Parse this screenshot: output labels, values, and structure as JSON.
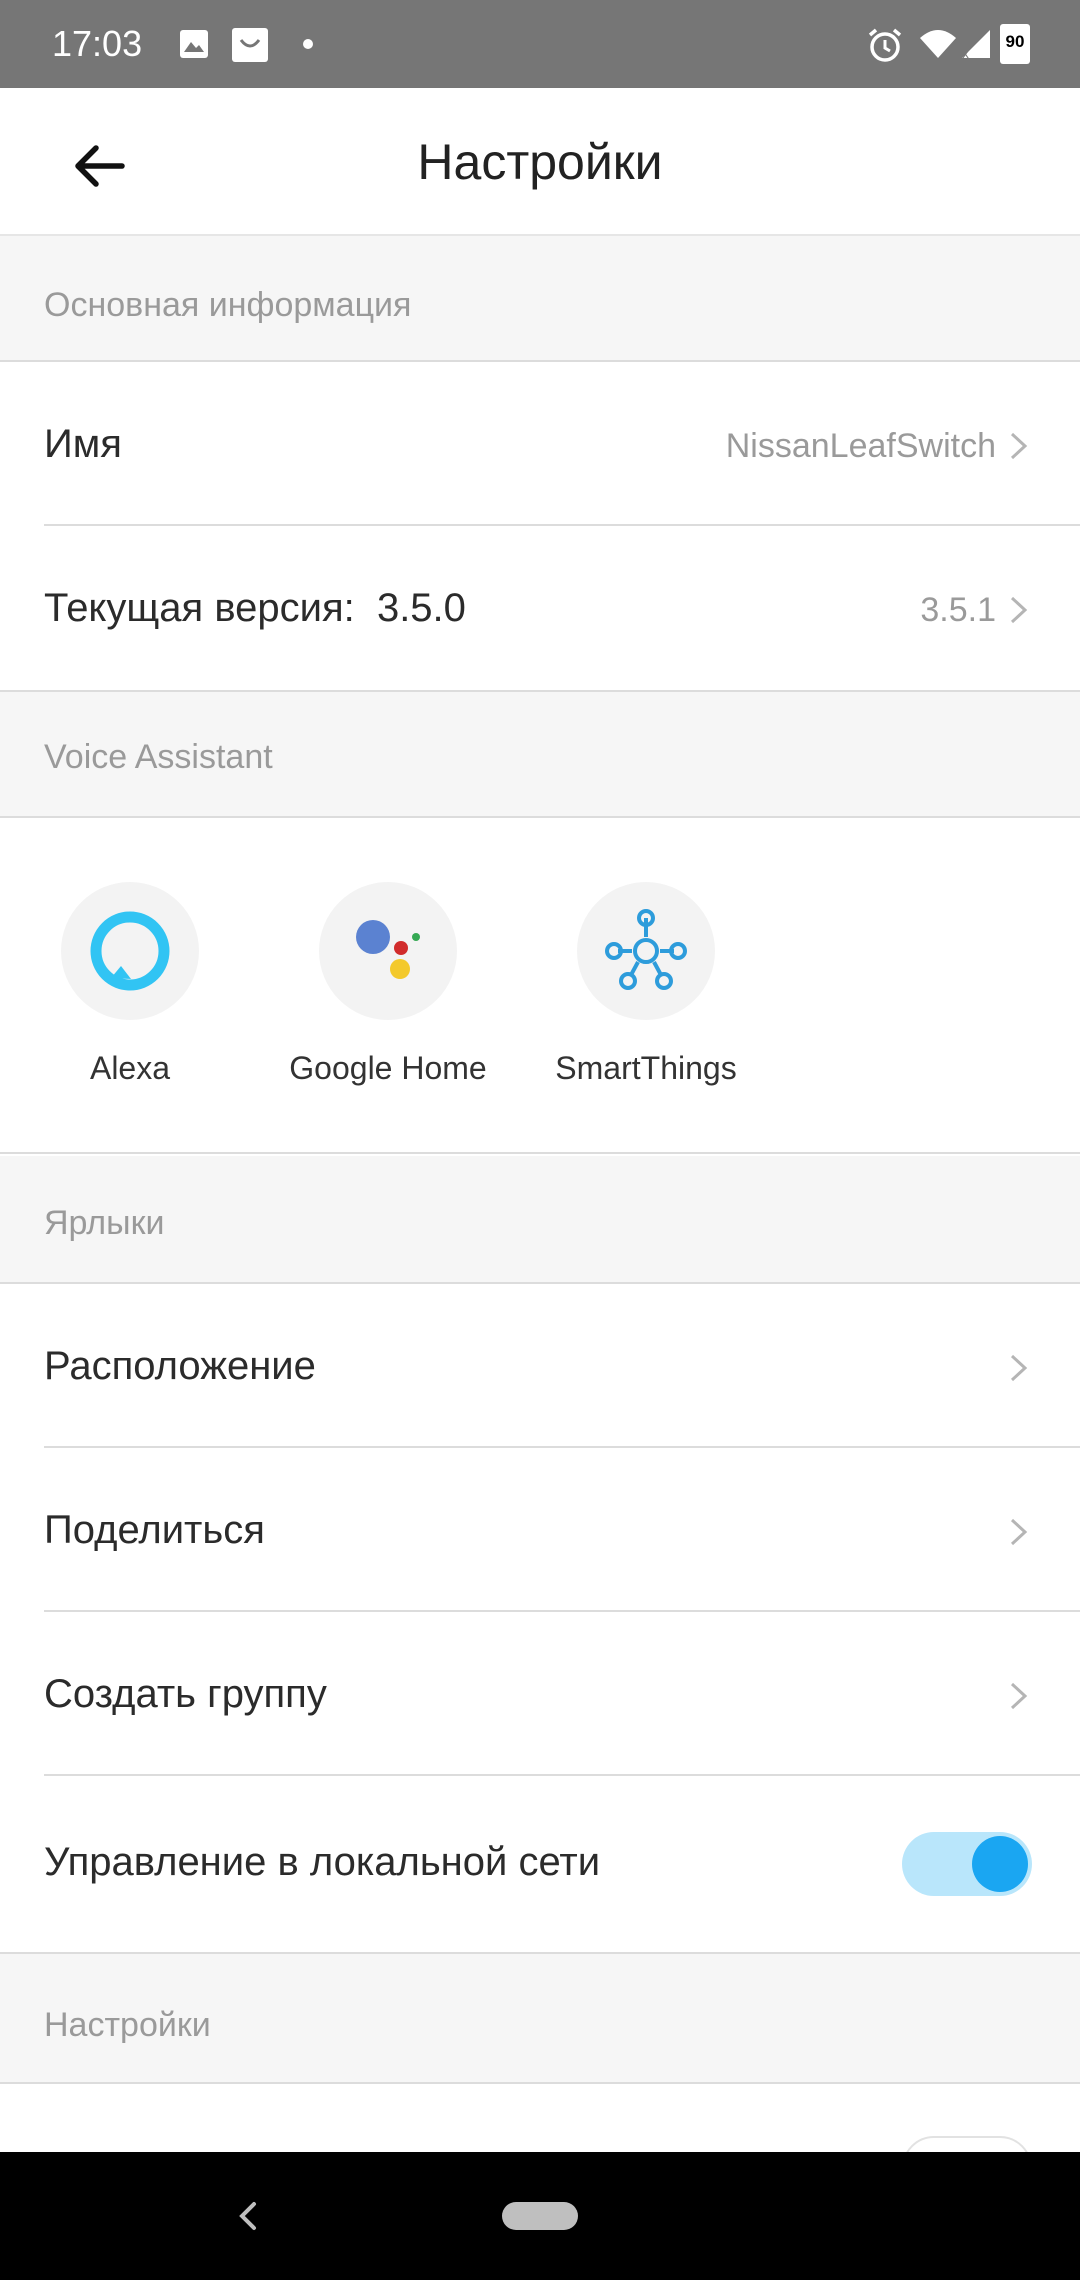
{
  "status_bar": {
    "time": "17:03",
    "battery_level": "90",
    "icons": [
      "image-icon",
      "shopping-bag-icon",
      "dot-icon",
      "alarm-icon",
      "wifi-icon",
      "signal-icon",
      "battery-icon"
    ]
  },
  "header": {
    "title": "Настройки",
    "back_icon": "arrow-left-icon"
  },
  "sections": {
    "basic_info": {
      "header": "Основная информация",
      "name_label": "Имя",
      "name_value": "NissanLeafSwitch",
      "version_label": "Текущая версия:  3.5.0",
      "version_value": "3.5.1"
    },
    "voice_assistant": {
      "header": "Voice Assistant",
      "items": [
        {
          "label": "Alexa",
          "icon": "alexa-icon"
        },
        {
          "label": "Google Home",
          "icon": "google-assistant-icon"
        },
        {
          "label": "SmartThings",
          "icon": "smartthings-icon"
        }
      ]
    },
    "shortcuts": {
      "header": "Ярлыки",
      "location_label": "Расположение",
      "share_label": "Поделиться",
      "create_group_label": "Создать группу",
      "local_control_label": "Управление в локальной сети",
      "local_control_on": true
    },
    "settings": {
      "header": "Настройки"
    }
  },
  "colors": {
    "status_bar": "#767676",
    "accent": "#1aa6f2",
    "toggle_track": "#b9e6fb",
    "section_bg": "#f6f6f6",
    "alexa": "#31c4f3",
    "smartthings": "#2d9cdb"
  }
}
